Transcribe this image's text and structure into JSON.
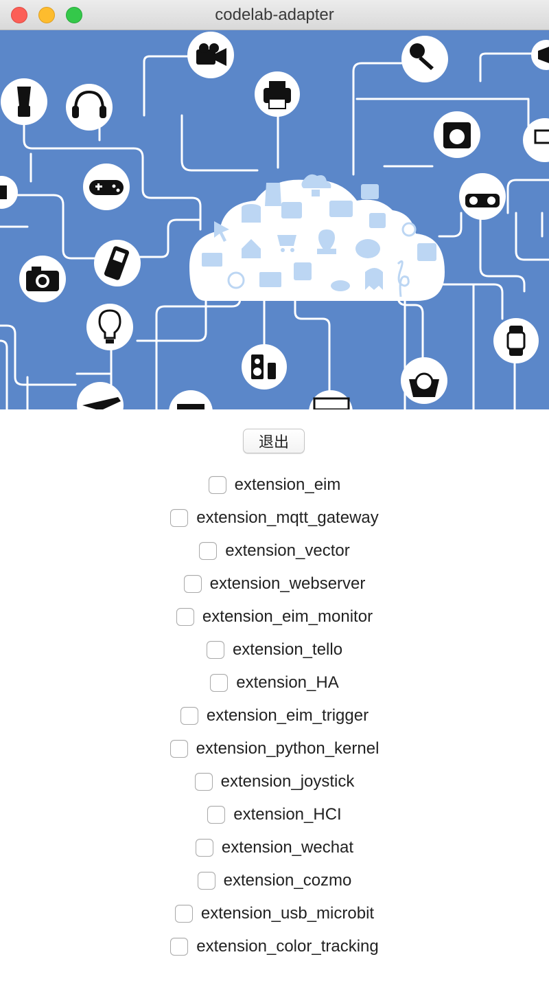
{
  "window": {
    "title": "codelab-adapter",
    "controls": [
      "close",
      "minimize",
      "zoom"
    ]
  },
  "banner": {
    "description_icons": [
      "blender-icon",
      "headset-icon",
      "video-camera-icon",
      "printer-icon",
      "microphone-icon",
      "washing-machine-icon",
      "monitor-icon",
      "gamepad-icon",
      "camera-icon",
      "phone-icon",
      "radio-icon",
      "lightbulb-icon",
      "speaker-icon",
      "scale-icon",
      "watch-icon",
      "airplane-icon",
      "cloud-icon"
    ],
    "colors": {
      "background": "#5b87c9",
      "cloud": "#ffffff",
      "cloud_icons": "#bcd6f3",
      "lines": "#ffffff"
    }
  },
  "quit_button": {
    "label": "退出"
  },
  "extensions": [
    {
      "label": "extension_eim",
      "checked": false
    },
    {
      "label": "extension_mqtt_gateway",
      "checked": false
    },
    {
      "label": "extension_vector",
      "checked": false
    },
    {
      "label": "extension_webserver",
      "checked": false
    },
    {
      "label": "extension_eim_monitor",
      "checked": false
    },
    {
      "label": "extension_tello",
      "checked": false
    },
    {
      "label": "extension_HA",
      "checked": false
    },
    {
      "label": "extension_eim_trigger",
      "checked": false
    },
    {
      "label": "extension_python_kernel",
      "checked": false
    },
    {
      "label": "extension_joystick",
      "checked": false
    },
    {
      "label": "extension_HCI",
      "checked": false
    },
    {
      "label": "extension_wechat",
      "checked": false
    },
    {
      "label": "extension_cozmo",
      "checked": false
    },
    {
      "label": "extension_usb_microbit",
      "checked": false
    },
    {
      "label": "extension_color_tracking",
      "checked": false
    }
  ]
}
